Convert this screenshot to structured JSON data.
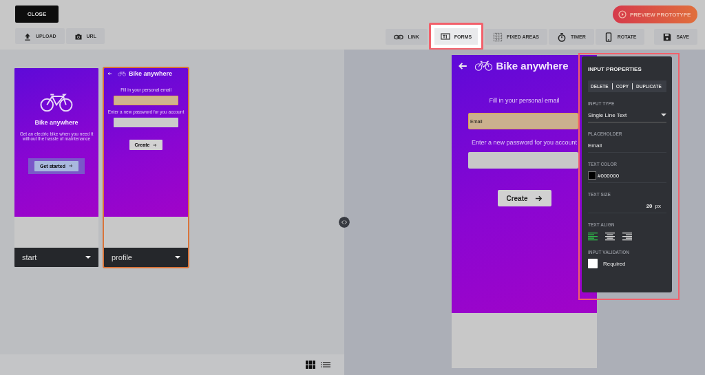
{
  "toolbar": {
    "close": "CLOSE",
    "sources": [
      {
        "kind": "upload",
        "label": "UPLOAD"
      },
      {
        "kind": "camera",
        "label": "URL"
      }
    ],
    "preview": "PREVIEW PROTOTYPE",
    "tools": [
      {
        "kind": "link",
        "label": "LINK",
        "selected": false
      },
      {
        "kind": "forms",
        "label": "FORMS",
        "selected": true
      },
      {
        "kind": "fixed",
        "label": "FIXED AREAS",
        "selected": false
      },
      {
        "kind": "timer",
        "label": "TIMER",
        "selected": false
      },
      {
        "kind": "rotate",
        "label": "ROTATE",
        "selected": false
      }
    ],
    "save": "SAVE"
  },
  "screens": [
    {
      "kind": "start",
      "name": "start",
      "selected": false,
      "title": "Bike anywhere",
      "description": "Get an electric bike when you need it without the hassle of maintenance",
      "button": "Get started"
    },
    {
      "kind": "form",
      "name": "profile",
      "selected": true,
      "title": "Bike anywhere",
      "fields": [
        {
          "label": "Fill in your personal email",
          "selected": true
        },
        {
          "label": "Enter a new password for you account",
          "selected": false
        }
      ],
      "button": "Create"
    }
  ],
  "view_modes": [
    {
      "kind": "grid",
      "selected": true
    },
    {
      "kind": "list",
      "selected": false
    }
  ],
  "preview": {
    "title": "Bike anywhere",
    "fields": [
      {
        "label": "Fill in your personal email",
        "value": "Email",
        "selected": true
      },
      {
        "label": "Enter a new password for you account",
        "selected": false
      }
    ],
    "button": "Create"
  },
  "properties": {
    "title": "INPUT PROPERTIES",
    "actions": [
      "DELETE",
      "COPY",
      "DUPLICATE"
    ],
    "input_type": {
      "label": "INPUT TYPE",
      "value": "Single Line Text"
    },
    "placeholder": {
      "label": "PLACEHOLDER",
      "value": "Email"
    },
    "text_color": {
      "label": "TEXT COLOR",
      "value": "#000000",
      "color": "#000000"
    },
    "text_size": {
      "label": "TEXT SIZE",
      "value": "20",
      "unit": "px"
    },
    "text_align": {
      "label": "TEXT ALIGN",
      "options": [
        {
          "kind": "left",
          "selected": true
        },
        {
          "kind": "center",
          "selected": false
        },
        {
          "kind": "right",
          "selected": false
        }
      ]
    },
    "validation": {
      "label": "INPUT VALIDATION",
      "options": [
        {
          "label": "Required",
          "checked": false
        }
      ]
    }
  }
}
